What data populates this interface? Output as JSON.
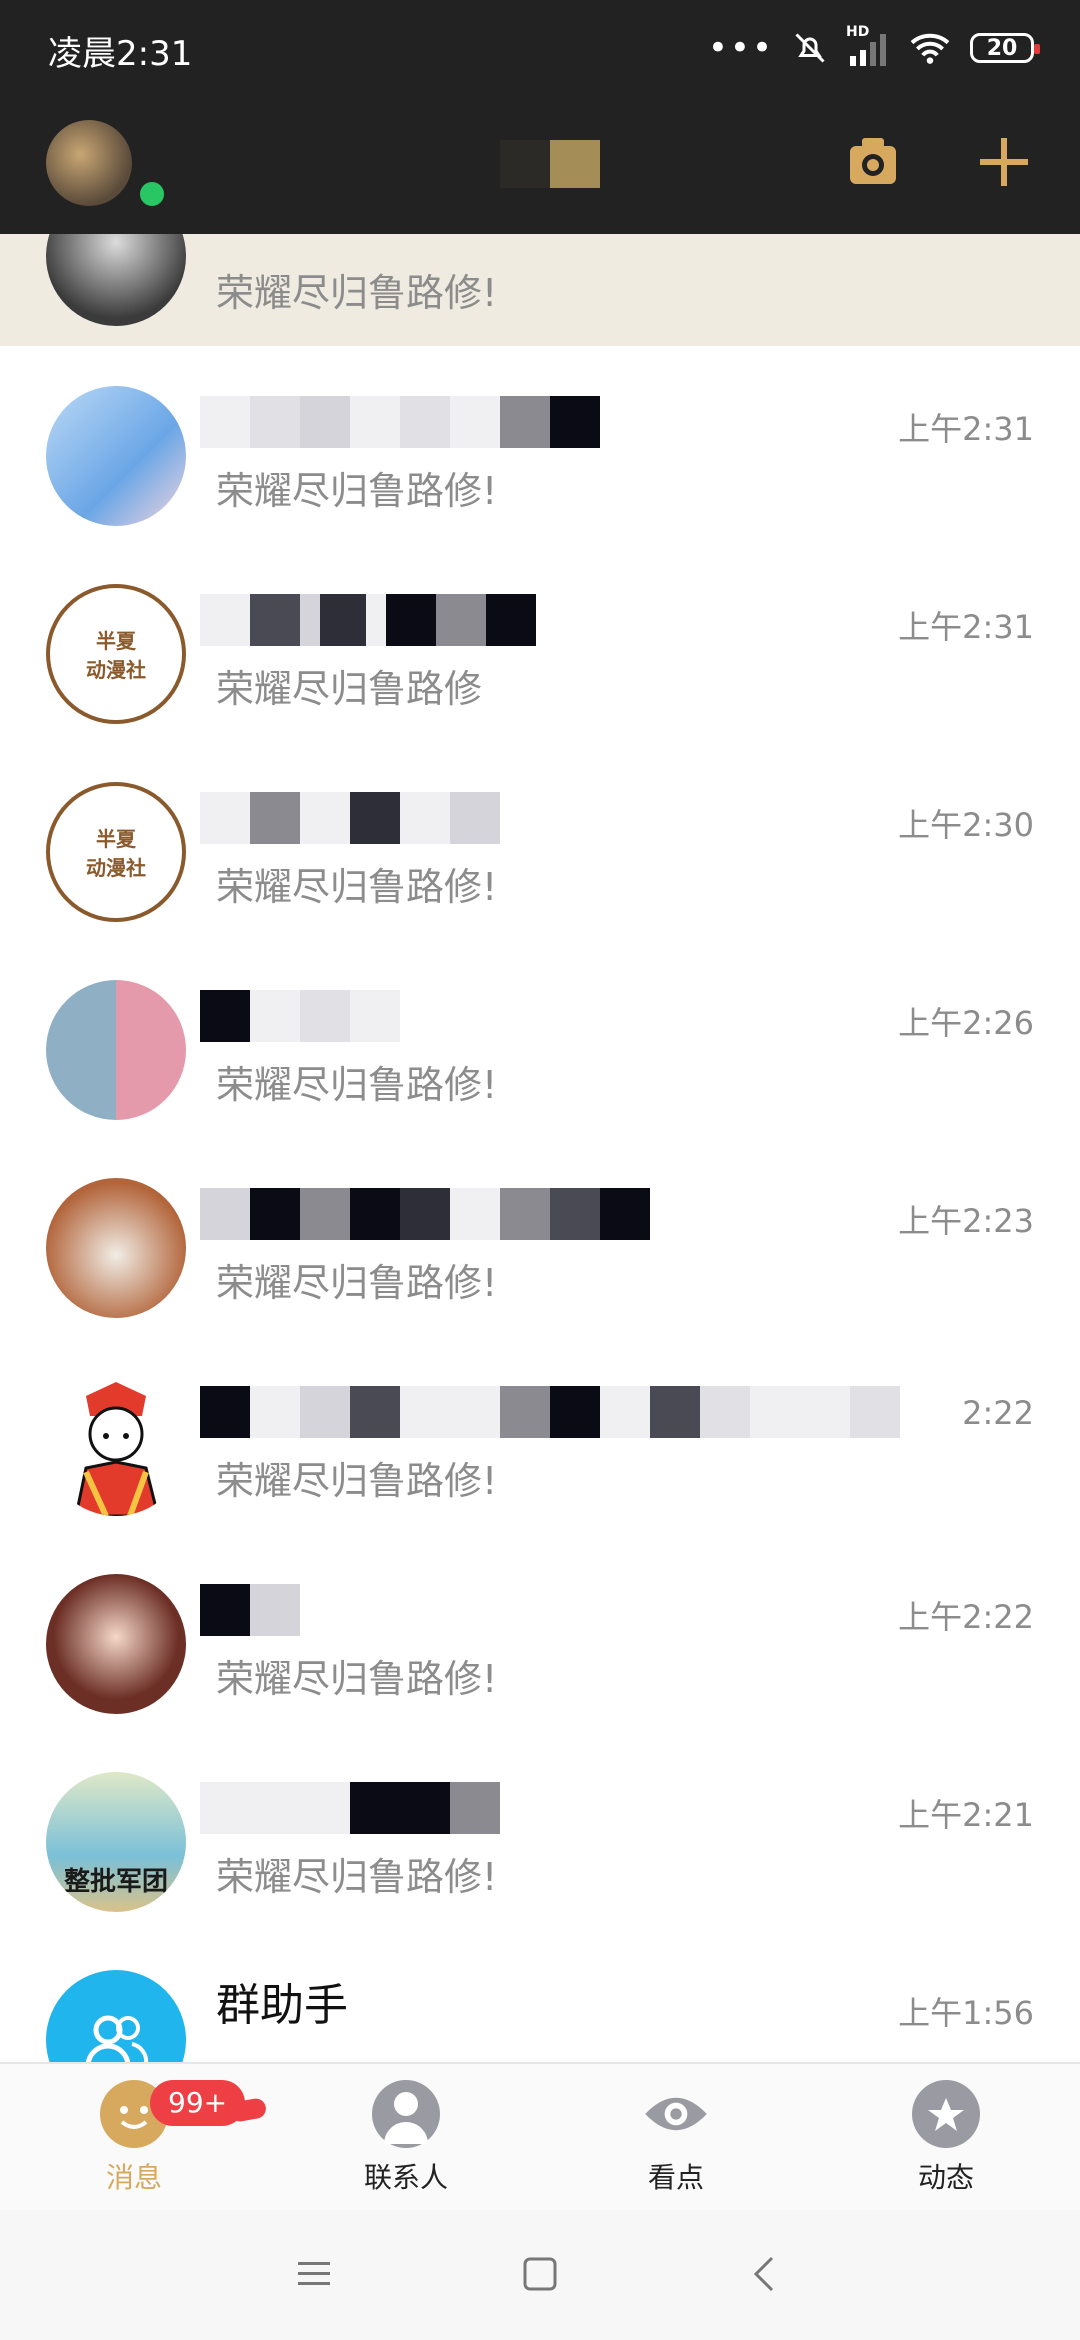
{
  "status_bar": {
    "time": "凌晨2:31",
    "hd_label": "HD",
    "battery": "20"
  },
  "colors": {
    "accent": "#d6a95f",
    "header_bg": "#222222",
    "pinned_bg": "#efebe0",
    "badge_red": "#ee3f44",
    "online_green": "#29c763"
  },
  "conversations": [
    {
      "time": "",
      "preview": "荣耀尽归鲁路修!"
    },
    {
      "time": "上午2:31",
      "preview": "荣耀尽归鲁路修!"
    },
    {
      "time": "上午2:31",
      "preview": "荣耀尽归鲁路修"
    },
    {
      "time": "上午2:30",
      "preview": "荣耀尽归鲁路修!"
    },
    {
      "time": "上午2:26",
      "preview": "荣耀尽归鲁路修!"
    },
    {
      "time": "上午2:23",
      "preview": "荣耀尽归鲁路修!"
    },
    {
      "time": "2:22",
      "preview": "荣耀尽归鲁路修!"
    },
    {
      "time": "上午2:22",
      "preview": "荣耀尽归鲁路修!"
    },
    {
      "time": "上午2:21",
      "preview": "荣耀尽归鲁路修!"
    },
    {
      "name": "群助手",
      "time": "上午1:56",
      "preview": ""
    }
  ],
  "avatar_labels": {
    "banxia_top": "半夏",
    "banxia_bottom": "动漫社",
    "squirtle": "整批军团"
  },
  "tabbar": {
    "messages": "消息",
    "contacts": "联系人",
    "kandian": "看点",
    "dongtai": "动态",
    "unread": "99+"
  }
}
